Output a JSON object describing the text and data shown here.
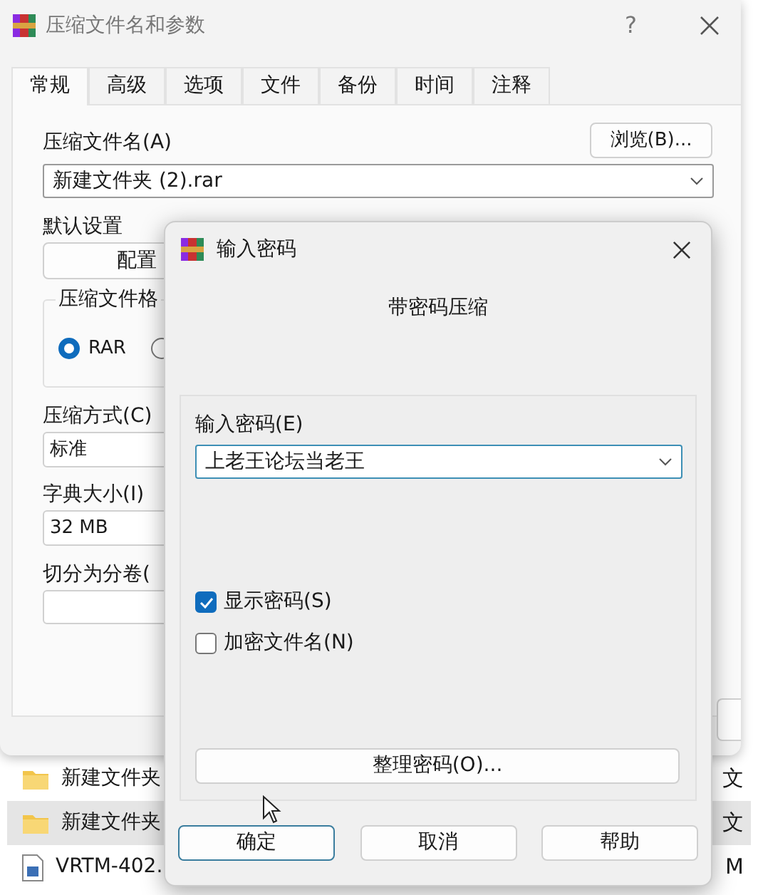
{
  "main_window": {
    "title": "压缩文件名和参数",
    "help_button": "?",
    "tabs": [
      {
        "label": "常规",
        "selected": true
      },
      {
        "label": "高级",
        "selected": false
      },
      {
        "label": "选项",
        "selected": false
      },
      {
        "label": "文件",
        "selected": false
      },
      {
        "label": "备份",
        "selected": false
      },
      {
        "label": "时间",
        "selected": false
      },
      {
        "label": "注释",
        "selected": false
      }
    ],
    "archive_name_label": "压缩文件名(A)",
    "browse_button": "浏览(B)...",
    "archive_name_value": "新建文件夹 (2).rar",
    "profile_label": "默认设置",
    "profile_button": "配置",
    "format_group_label": "压缩文件格",
    "format_options": [
      {
        "label": "RAR",
        "selected": true
      },
      {
        "selected": false
      }
    ],
    "method_label": "压缩方式(C)",
    "method_value": "标准",
    "dictionary_label": "字典大小(I)",
    "dictionary_value": "32 MB",
    "split_label": "切分为分卷("
  },
  "file_list": {
    "rows": [
      {
        "kind": "folder",
        "name": "新建文件夹",
        "type": "文",
        "selected": false
      },
      {
        "kind": "folder",
        "name": "新建文件夹",
        "type": "文",
        "selected": true
      },
      {
        "kind": "file",
        "name": "VRTM-402.",
        "type": "M",
        "selected": false
      }
    ]
  },
  "password_dialog": {
    "title": "输入密码",
    "heading": "带密码压缩",
    "password_label": "输入密码(E)",
    "password_value": "上老王论坛当老王",
    "options": [
      {
        "label": "显示密码(S)",
        "checked": true
      },
      {
        "label": "加密文件名(N)",
        "checked": false
      }
    ],
    "organize_button": "整理密码(O)...",
    "buttons": [
      {
        "label": "确定",
        "default": true
      },
      {
        "label": "取消",
        "default": false
      },
      {
        "label": "帮助",
        "default": false
      }
    ]
  }
}
